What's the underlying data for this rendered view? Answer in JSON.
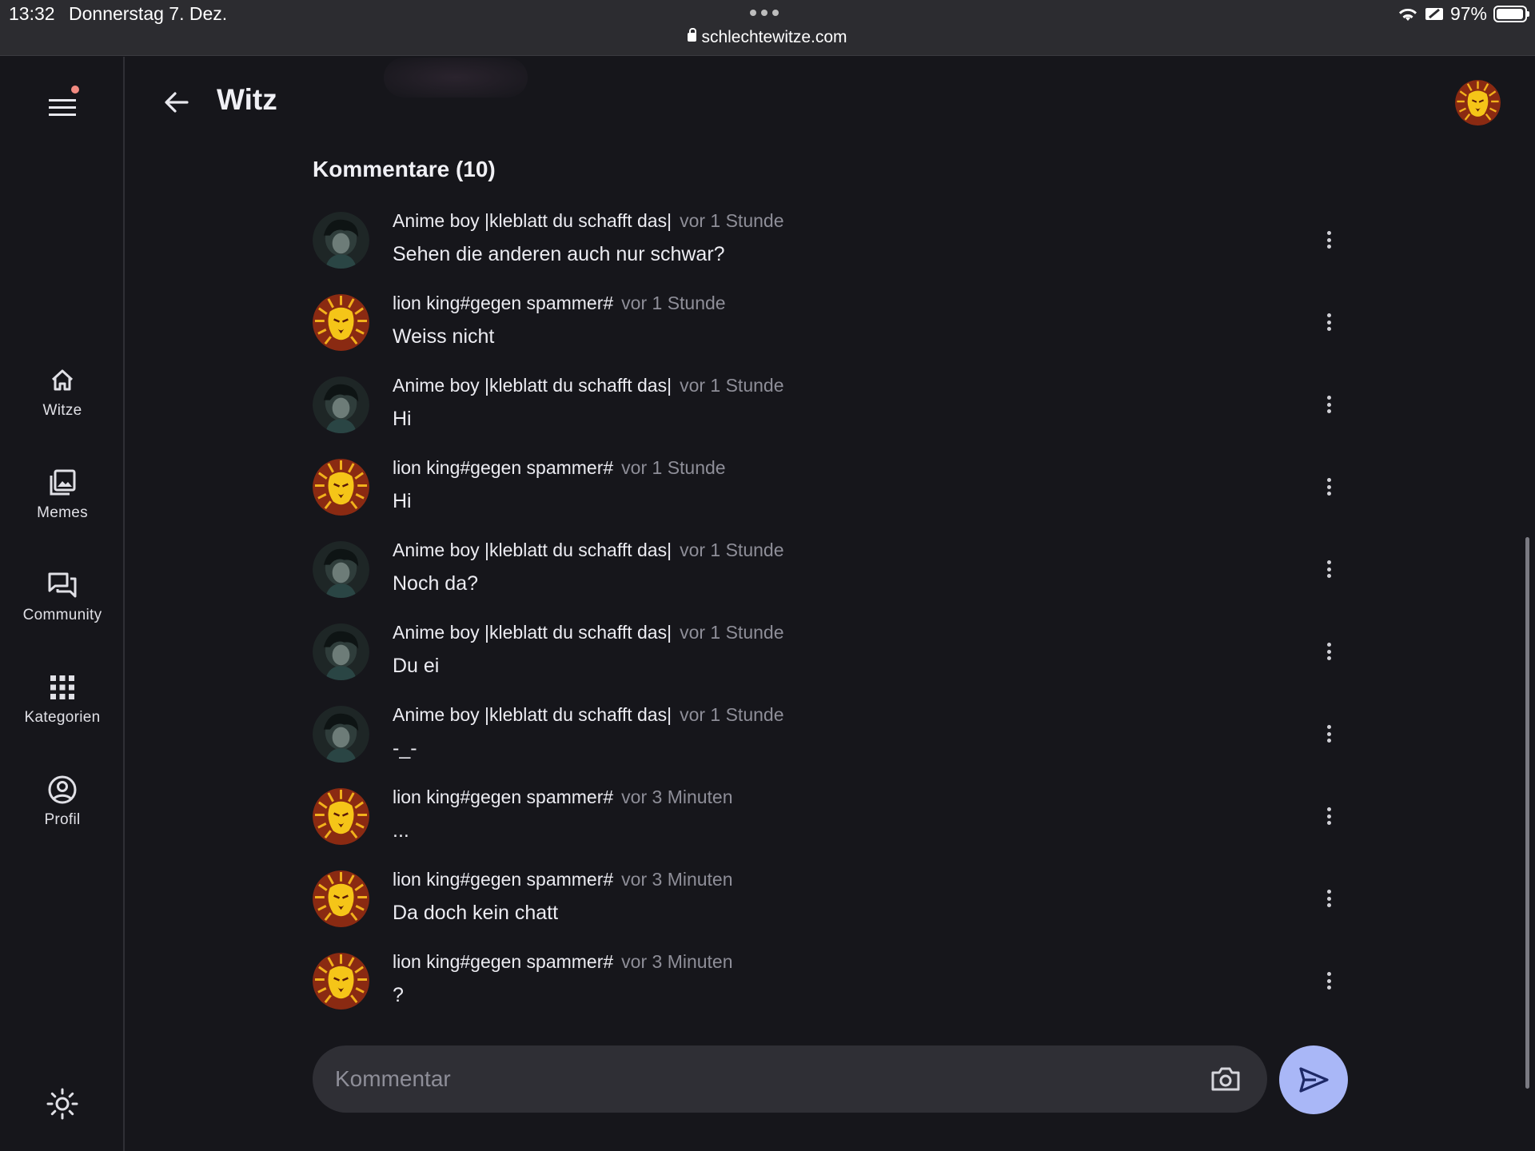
{
  "status_bar": {
    "time": "13:32",
    "date": "Donnerstag 7. Dez.",
    "url": "schlechtewitze.com",
    "battery": "97%",
    "battery_level": 0.97
  },
  "sidebar": {
    "items": [
      {
        "label": "Witze",
        "icon": "home-icon"
      },
      {
        "label": "Memes",
        "icon": "images-icon"
      },
      {
        "label": "Community",
        "icon": "forum-icon"
      },
      {
        "label": "Kategorien",
        "icon": "grid-icon"
      },
      {
        "label": "Profil",
        "icon": "account-circle-icon"
      }
    ]
  },
  "header": {
    "title": "Witz"
  },
  "comments": {
    "heading": "Kommentare (10)",
    "items": [
      {
        "author": "Anime boy |kleblatt du schafft das|",
        "time": "vor 1 Stunde",
        "text": "Sehen die anderen auch nur schwar?",
        "avatar": "anime"
      },
      {
        "author": "lion king#gegen spammer#",
        "time": "vor 1 Stunde",
        "text": "Weiss nicht",
        "avatar": "lion"
      },
      {
        "author": "Anime boy |kleblatt du schafft das|",
        "time": "vor 1 Stunde",
        "text": "Hi",
        "avatar": "anime"
      },
      {
        "author": "lion king#gegen spammer#",
        "time": "vor 1 Stunde",
        "text": "Hi",
        "avatar": "lion"
      },
      {
        "author": "Anime boy |kleblatt du schafft das|",
        "time": "vor 1 Stunde",
        "text": "Noch da?",
        "avatar": "anime"
      },
      {
        "author": "Anime boy |kleblatt du schafft das|",
        "time": "vor 1 Stunde",
        "text": "Du ei",
        "avatar": "anime"
      },
      {
        "author": "Anime boy |kleblatt du schafft das|",
        "time": "vor 1 Stunde",
        "text": "-_-",
        "avatar": "anime"
      },
      {
        "author": "lion king#gegen spammer#",
        "time": "vor 3 Minuten",
        "text": "...",
        "avatar": "lion"
      },
      {
        "author": "lion king#gegen spammer#",
        "time": "vor 3 Minuten",
        "text": "Da doch kein chatt",
        "avatar": "lion"
      },
      {
        "author": "lion king#gegen spammer#",
        "time": "vor 3 Minuten",
        "text": "?",
        "avatar": "lion"
      }
    ]
  },
  "composer": {
    "placeholder": "Kommentar"
  },
  "colors": {
    "background": "#16161b",
    "accent": "#a9b7f7",
    "notification": "#f28b82"
  }
}
